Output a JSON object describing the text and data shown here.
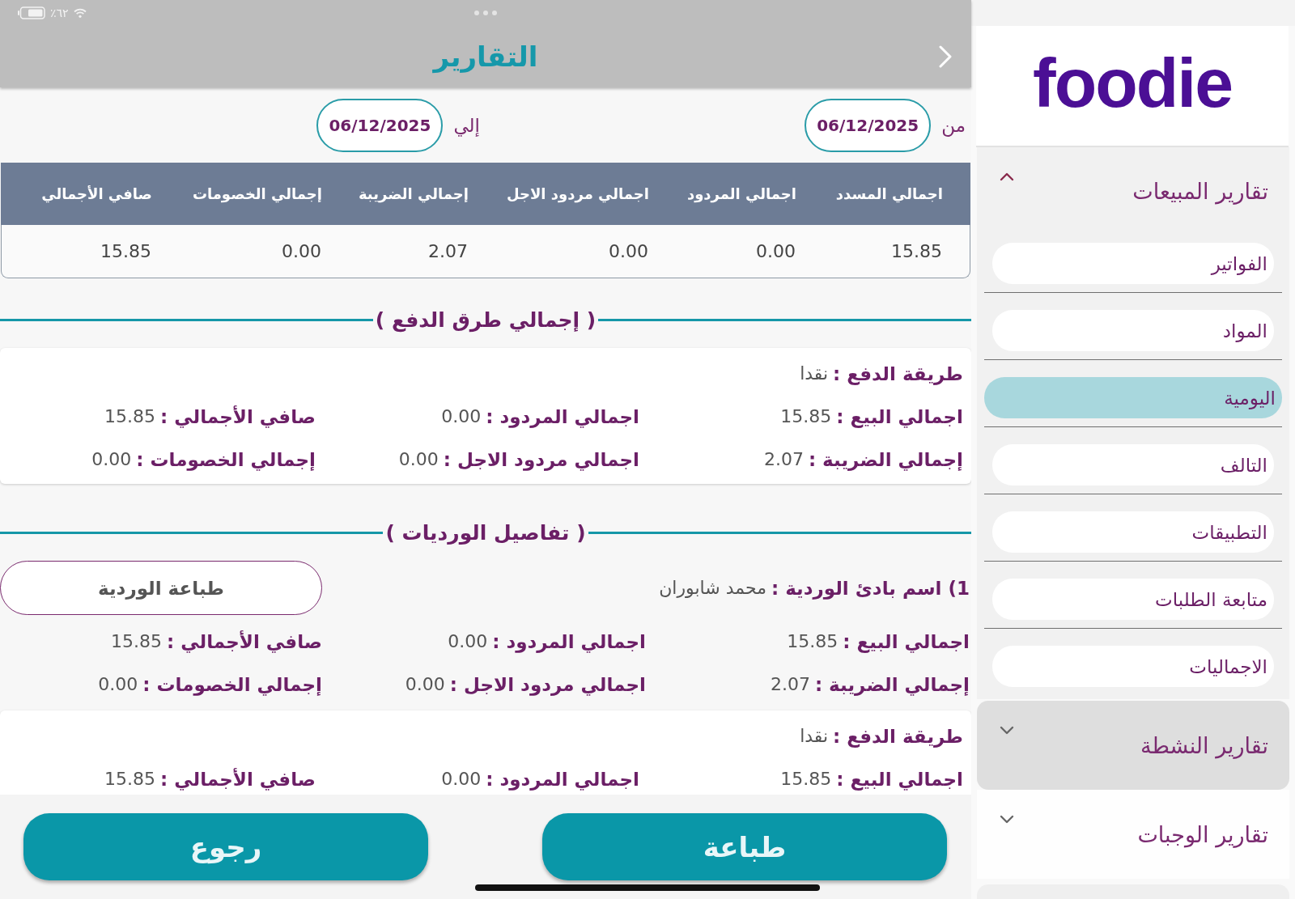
{
  "status_bar": {
    "battery_text": "٪٦٢"
  },
  "header": {
    "title": "التقارير"
  },
  "date_range": {
    "from": {
      "label": "من",
      "value": "06/12/2025"
    },
    "to": {
      "label": "إلي",
      "value": "06/12/2025"
    }
  },
  "summary_table": {
    "columns": [
      "اجمالي المسدد",
      "اجمالي المردود",
      "اجمالي مردود الاجل",
      "إجمالي الضريبة",
      "إجمالي الخصومات",
      "صافي الأجمالي"
    ],
    "rows": [
      [
        "15.85",
        "0.00",
        "0.00",
        "2.07",
        "0.00",
        "15.85"
      ]
    ]
  },
  "payment_totals": {
    "heading": "( إجمالي طرق الدفع )",
    "methods": [
      {
        "method": {
          "label": "طريقة الدفع :",
          "value": "نقدا"
        },
        "fields": [
          {
            "label": "اجمالي البيع :",
            "value": "15.85"
          },
          {
            "label": "اجمالي المردود :",
            "value": "0.00"
          },
          {
            "label": "صافي الأجمالي :",
            "value": "15.85"
          },
          {
            "label": "إجمالي الضريبة :",
            "value": "2.07"
          },
          {
            "label": "اجمالي مردود الاجل :",
            "value": "0.00"
          },
          {
            "label": "إجمالي الخصومات :",
            "value": "0.00"
          }
        ]
      }
    ]
  },
  "shift_details": {
    "heading": "( تفاصيل الورديات )",
    "shifts": [
      {
        "starter": {
          "label": "1) اسم بادئ الوردية :",
          "value": "محمد شابوران"
        },
        "print_label": "طباعة الوردية",
        "fields": [
          {
            "label": "اجمالي البيع :",
            "value": "15.85"
          },
          {
            "label": "اجمالي المردود :",
            "value": "0.00"
          },
          {
            "label": "صافي الأجمالي :",
            "value": "15.85"
          },
          {
            "label": "إجمالي الضريبة :",
            "value": "2.07"
          },
          {
            "label": "اجمالي مردود الاجل :",
            "value": "0.00"
          },
          {
            "label": "إجمالي الخصومات :",
            "value": "0.00"
          }
        ],
        "payments": [
          {
            "method": {
              "label": "طريقة الدفع :",
              "value": "نقدا"
            },
            "fields": [
              {
                "label": "اجمالي البيع :",
                "value": "15.85"
              },
              {
                "label": "اجمالي المردود :",
                "value": "0.00"
              },
              {
                "label": "صافي الأجمالي :",
                "value": "15.85"
              }
            ]
          }
        ]
      }
    ]
  },
  "actions": [
    {
      "label": "طباعة"
    },
    {
      "label": "رجوع"
    }
  ],
  "sidebar": {
    "logo": "foodie",
    "groups": [
      {
        "title": "تقارير المبيعات",
        "expanded": true,
        "highlighted": false,
        "items": [
          {
            "label": "الفواتير",
            "selected": false
          },
          {
            "label": "المواد",
            "selected": false
          },
          {
            "label": "اليومية",
            "selected": true
          },
          {
            "label": "التالف",
            "selected": false
          },
          {
            "label": "التطبيقات",
            "selected": false
          },
          {
            "label": "متابعة الطلبات",
            "selected": false
          },
          {
            "label": "الاجماليات",
            "selected": false
          }
        ]
      },
      {
        "title": "تقارير النشطة",
        "expanded": false,
        "highlighted": true
      },
      {
        "title": "تقارير الوجبات",
        "expanded": false,
        "highlighted": false
      }
    ]
  }
}
